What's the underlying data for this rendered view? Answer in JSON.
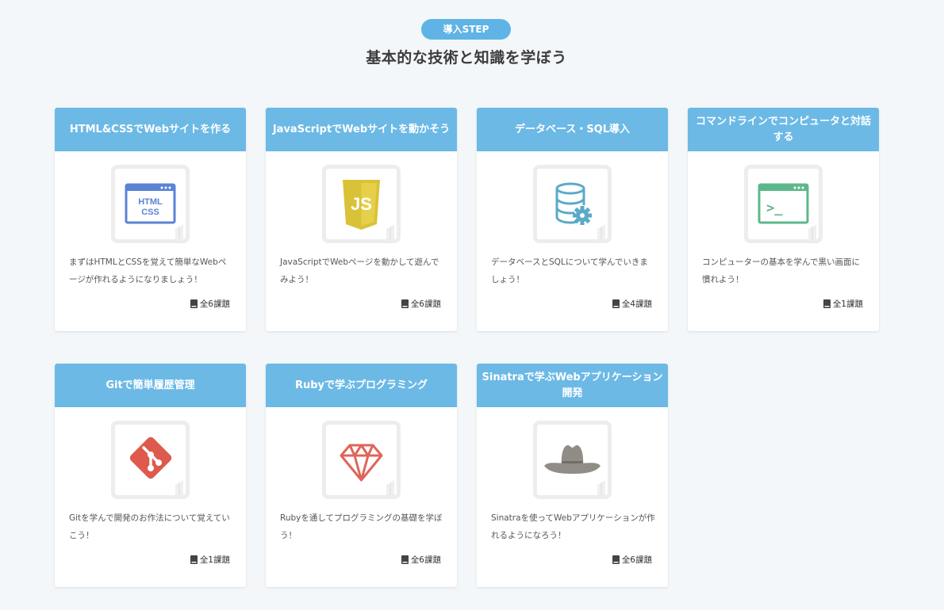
{
  "header": {
    "badge": "導入STEP",
    "title": "基本的な技術と知識を学ぼう"
  },
  "colors": {
    "accent": "#6cb9e6",
    "badge": "#5fb4e5",
    "background": "#f3f7f9"
  },
  "courses": [
    {
      "title": "HTML&CSSでWebサイトを作る",
      "icon": "html-css-icon",
      "icon_text": [
        "HTML",
        "CSS"
      ],
      "description": "まずはHTMLとCSSを覚えて簡単なWebページが作れるようになりましょう！",
      "count": "全6課題"
    },
    {
      "title": "JavaScriptでWebサイトを動かそう",
      "icon": "javascript-icon",
      "icon_text": [
        "JS"
      ],
      "description": "JavaScriptでWebページを動かして遊んでみよう！",
      "count": "全6課題"
    },
    {
      "title": "データベース・SQL導入",
      "icon": "database-icon",
      "description": "データベースとSQLについて学んでいきましょう！",
      "count": "全4課題"
    },
    {
      "title": "コマンドラインでコンピュータと対話する",
      "icon": "terminal-icon",
      "icon_text": [
        ">_"
      ],
      "description": "コンピューターの基本を学んで黒い画面に慣れよう！",
      "count": "全1課題"
    },
    {
      "title": "Gitで簡単履歴管理",
      "icon": "git-icon",
      "description": "Gitを学んで開発のお作法について覚えていこう！",
      "count": "全1課題"
    },
    {
      "title": "Rubyで学ぶプログラミング",
      "icon": "ruby-icon",
      "description": "Rubyを通してプログラミングの基礎を学ぼう！",
      "count": "全6課題"
    },
    {
      "title": "Sinatraで学ぶWebアプリケーション開発",
      "icon": "sinatra-hat-icon",
      "description": "Sinatraを使ってWebアプリケーションが作れるようになろう！",
      "count": "全6課題"
    }
  ]
}
